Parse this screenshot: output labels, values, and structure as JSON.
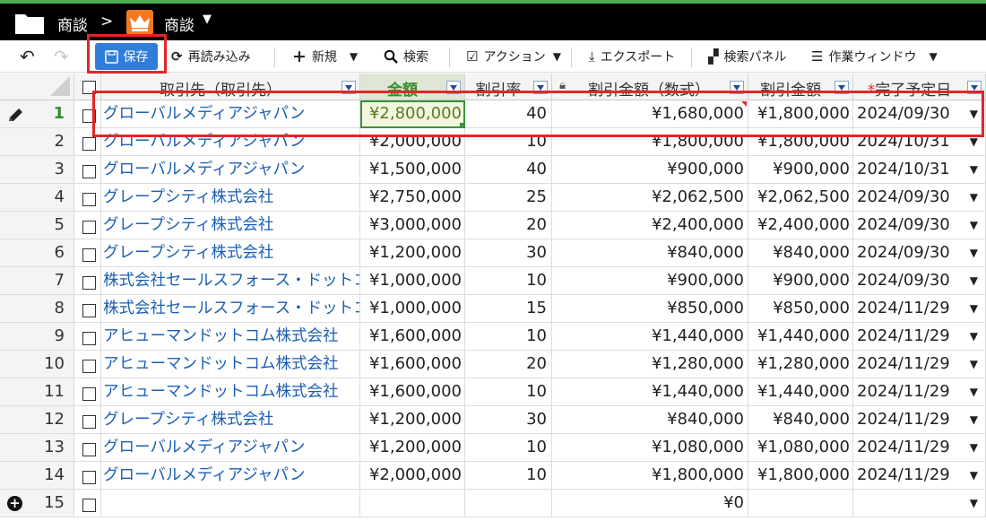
{
  "breadcrumb": {
    "parent": "商談",
    "separator": ">",
    "current": "商談"
  },
  "toolbar": {
    "save": "保存",
    "reload": "再読み込み",
    "new": "新規",
    "search": "検索",
    "action": "アクション",
    "export": "エクスポート",
    "search_panel": "検索パネル",
    "work_window": "作業ウィンドウ"
  },
  "columns": {
    "account": "取引先（取引先）",
    "amount": "金額",
    "rate": "割引率",
    "formula_discount": "割引金額（数式）",
    "discount": "割引金額",
    "close_date_req": "*",
    "close_date": "完了予定日"
  },
  "rows": [
    {
      "num": "1",
      "account": "グローバルメディアジャパン",
      "amount": "¥2,800,000",
      "rate": "40",
      "formula_discount": "¥1,680,000",
      "discount": "¥1,800,000",
      "date": "2024/09/30"
    },
    {
      "num": "2",
      "account": "グローバルメディアジャパン",
      "amount": "¥2,000,000",
      "rate": "10",
      "formula_discount": "¥1,800,000",
      "discount": "¥1,800,000",
      "date": "2024/10/31"
    },
    {
      "num": "3",
      "account": "グローバルメディアジャパン",
      "amount": "¥1,500,000",
      "rate": "40",
      "formula_discount": "¥900,000",
      "discount": "¥900,000",
      "date": "2024/10/31"
    },
    {
      "num": "4",
      "account": "グレープシティ株式会社",
      "amount": "¥2,750,000",
      "rate": "25",
      "formula_discount": "¥2,062,500",
      "discount": "¥2,062,500",
      "date": "2024/09/30"
    },
    {
      "num": "5",
      "account": "グレープシティ株式会社",
      "amount": "¥3,000,000",
      "rate": "20",
      "formula_discount": "¥2,400,000",
      "discount": "¥2,400,000",
      "date": "2024/09/30"
    },
    {
      "num": "6",
      "account": "グレープシティ株式会社",
      "amount": "¥1,200,000",
      "rate": "30",
      "formula_discount": "¥840,000",
      "discount": "¥840,000",
      "date": "2024/09/30"
    },
    {
      "num": "7",
      "account": "株式会社セールスフォース・ドットコム",
      "amount": "¥1,000,000",
      "rate": "10",
      "formula_discount": "¥900,000",
      "discount": "¥900,000",
      "date": "2024/09/30"
    },
    {
      "num": "8",
      "account": "株式会社セールスフォース・ドットコム",
      "amount": "¥1,000,000",
      "rate": "15",
      "formula_discount": "¥850,000",
      "discount": "¥850,000",
      "date": "2024/11/29"
    },
    {
      "num": "9",
      "account": "アヒューマンドットコム株式会社",
      "amount": "¥1,600,000",
      "rate": "10",
      "formula_discount": "¥1,440,000",
      "discount": "¥1,440,000",
      "date": "2024/11/29"
    },
    {
      "num": "10",
      "account": "アヒューマンドットコム株式会社",
      "amount": "¥1,600,000",
      "rate": "20",
      "formula_discount": "¥1,280,000",
      "discount": "¥1,280,000",
      "date": "2024/11/29"
    },
    {
      "num": "11",
      "account": "アヒューマンドットコム株式会社",
      "amount": "¥1,600,000",
      "rate": "10",
      "formula_discount": "¥1,440,000",
      "discount": "¥1,440,000",
      "date": "2024/11/29"
    },
    {
      "num": "12",
      "account": "グレープシティ株式会社",
      "amount": "¥1,200,000",
      "rate": "30",
      "formula_discount": "¥840,000",
      "discount": "¥840,000",
      "date": "2024/11/29"
    },
    {
      "num": "13",
      "account": "グローバルメディアジャパン",
      "amount": "¥1,200,000",
      "rate": "10",
      "formula_discount": "¥1,080,000",
      "discount": "¥1,080,000",
      "date": "2024/11/29"
    },
    {
      "num": "14",
      "account": "グローバルメディアジャパン",
      "amount": "¥2,000,000",
      "rate": "10",
      "formula_discount": "¥1,800,000",
      "discount": "¥1,800,000",
      "date": "2024/11/29"
    }
  ],
  "new_row": {
    "num": "15",
    "formula_discount": "¥0"
  },
  "icons": {
    "folder": "folder-icon",
    "app": "crown-icon",
    "undo": "undo-icon",
    "redo": "redo-icon",
    "save": "floppy-icon",
    "reload": "reload-icon",
    "new": "plus-icon",
    "search": "magnifier-icon",
    "action": "checkbox-icon",
    "export": "download-icon",
    "search_panel": "binoculars-icon",
    "work_window": "list-icon",
    "edit": "pencil-icon",
    "add_row": "plus-circle-icon",
    "lock": "lock-icon"
  },
  "colors": {
    "accent": "#2f7fd8",
    "highlight": "#e32626",
    "link": "#1a5fb4",
    "active": "#2f8f2f",
    "topbar": "#000000",
    "app_icon": "#f47a21"
  }
}
